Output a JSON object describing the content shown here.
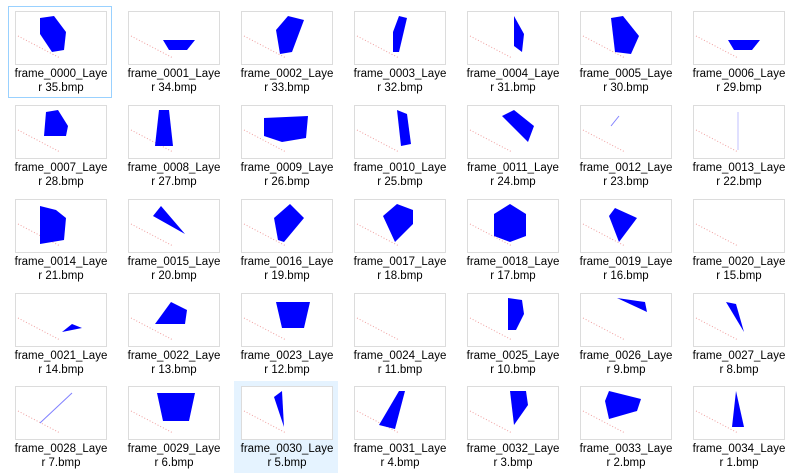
{
  "files": [
    {
      "line1": "frame_0000_Laye",
      "line2": "r 35.bmp"
    },
    {
      "line1": "frame_0001_Laye",
      "line2": "r 34.bmp"
    },
    {
      "line1": "frame_0002_Laye",
      "line2": "r 33.bmp"
    },
    {
      "line1": "frame_0003_Laye",
      "line2": "r 32.bmp"
    },
    {
      "line1": "frame_0004_Laye",
      "line2": "r 31.bmp"
    },
    {
      "line1": "frame_0005_Laye",
      "line2": "r 30.bmp"
    },
    {
      "line1": "frame_0006_Laye",
      "line2": "r 29.bmp"
    },
    {
      "line1": "frame_0007_Laye",
      "line2": "r 28.bmp"
    },
    {
      "line1": "frame_0008_Laye",
      "line2": "r 27.bmp"
    },
    {
      "line1": "frame_0009_Laye",
      "line2": "r 26.bmp"
    },
    {
      "line1": "frame_0010_Laye",
      "line2": "r 25.bmp"
    },
    {
      "line1": "frame_0011_Laye",
      "line2": "r 24.bmp"
    },
    {
      "line1": "frame_0012_Laye",
      "line2": "r 23.bmp"
    },
    {
      "line1": "frame_0013_Laye",
      "line2": "r 22.bmp"
    },
    {
      "line1": "frame_0014_Laye",
      "line2": "r 21.bmp"
    },
    {
      "line1": "frame_0015_Laye",
      "line2": "r 20.bmp"
    },
    {
      "line1": "frame_0016_Laye",
      "line2": "r 19.bmp"
    },
    {
      "line1": "frame_0017_Laye",
      "line2": "r 18.bmp"
    },
    {
      "line1": "frame_0018_Laye",
      "line2": "r 17.bmp"
    },
    {
      "line1": "frame_0019_Laye",
      "line2": "r 16.bmp"
    },
    {
      "line1": "frame_0020_Laye",
      "line2": "r 15.bmp"
    },
    {
      "line1": "frame_0021_Laye",
      "line2": "r 14.bmp"
    },
    {
      "line1": "frame_0022_Laye",
      "line2": "r 13.bmp"
    },
    {
      "line1": "frame_0023_Laye",
      "line2": "r 12.bmp"
    },
    {
      "line1": "frame_0024_Laye",
      "line2": "r 11.bmp"
    },
    {
      "line1": "frame_0025_Laye",
      "line2": "r 10.bmp"
    },
    {
      "line1": "frame_0026_Laye",
      "line2": "r 9.bmp"
    },
    {
      "line1": "frame_0027_Laye",
      "line2": "r 8.bmp"
    },
    {
      "line1": "frame_0028_Laye",
      "line2": "r 7.bmp"
    },
    {
      "line1": "frame_0029_Laye",
      "line2": "r 6.bmp"
    },
    {
      "line1": "frame_0030_Laye",
      "line2": "r 5.bmp"
    },
    {
      "line1": "frame_0031_Laye",
      "line2": "r 4.bmp"
    },
    {
      "line1": "frame_0032_Laye",
      "line2": "r 3.bmp"
    },
    {
      "line1": "frame_0033_Laye",
      "line2": "r 2.bmp"
    },
    {
      "line1": "frame_0034_Laye",
      "line2": "r 1.bmp"
    }
  ],
  "colors": {
    "shape": "#0000ff",
    "trail": "#f0a0a0",
    "selected_border": "#99d1ff",
    "hover_bg": "#e5f3ff"
  }
}
